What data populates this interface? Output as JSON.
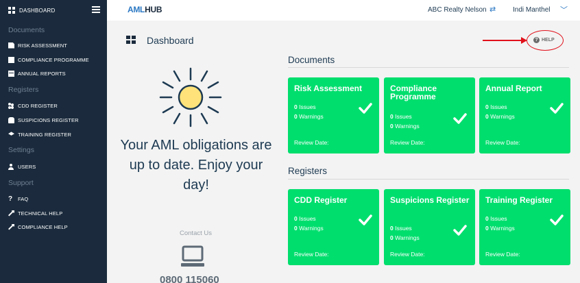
{
  "sidebar": {
    "dashboard_label": "DASHBOARD",
    "sections": {
      "documents": "Documents",
      "registers": "Registers",
      "settings": "Settings",
      "support": "Support"
    },
    "items": {
      "risk_assessment": "RISK ASSESSMENT",
      "compliance_programme": "COMPLIANCE PROGRAMME",
      "annual_reports": "ANNUAL REPORTS",
      "cdd_register": "CDD REGISTER",
      "suspicions_register": "SUSPICIONS REGISTER",
      "training_register": "TRAINING REGISTER",
      "users": "USERS",
      "faq": "FAQ",
      "technical_help": "TECHNICAL HELP",
      "compliance_help": "COMPLIANCE HELP"
    }
  },
  "topbar": {
    "logo_aml": "AML",
    "logo_hub": "HUB",
    "organization": "ABC Realty Nelson",
    "swap_icon": "⇄",
    "user_name": "Indi Manthel",
    "chevron_icon": "﹀"
  },
  "page": {
    "title": "Dashboard",
    "help_label": "HELP",
    "help_icon": "?"
  },
  "hero": {
    "message": "Your AML obligations are up to date. Enjoy your day!",
    "contact_label": "Contact Us",
    "phone": "0800 115060"
  },
  "documents": {
    "title": "Documents",
    "cards": [
      {
        "title": "Risk Assessment",
        "issues_count": "0",
        "issues_label": "Issues",
        "warnings_count": "0",
        "warnings_label": "Warnings",
        "review": "Review Date:"
      },
      {
        "title": "Compliance Programme",
        "issues_count": "0",
        "issues_label": "Issues",
        "warnings_count": "0",
        "warnings_label": "Warnings",
        "review": "Review Date:"
      },
      {
        "title": "Annual Report",
        "issues_count": "0",
        "issues_label": "Issues",
        "warnings_count": "0",
        "warnings_label": "Warnings",
        "review": "Review Date:"
      }
    ]
  },
  "registers": {
    "title": "Registers",
    "cards": [
      {
        "title": "CDD Register",
        "issues_count": "0",
        "issues_label": "Issues",
        "warnings_count": "0",
        "warnings_label": "Warnings",
        "review": "Review Date:"
      },
      {
        "title": "Suspicions Register",
        "issues_count": "0",
        "issues_label": "Issues",
        "warnings_count": "0",
        "warnings_label": "Warnings",
        "review": "Review Date:"
      },
      {
        "title": "Training Register",
        "issues_count": "0",
        "issues_label": "Issues",
        "warnings_count": "0",
        "warnings_label": "Warnings",
        "review": "Review Date:"
      }
    ]
  },
  "colors": {
    "sidebar_bg": "#1b2b3d",
    "card_green": "#00de6d",
    "accent_blue": "#2b78c4",
    "annotation_red": "#e0101a"
  }
}
